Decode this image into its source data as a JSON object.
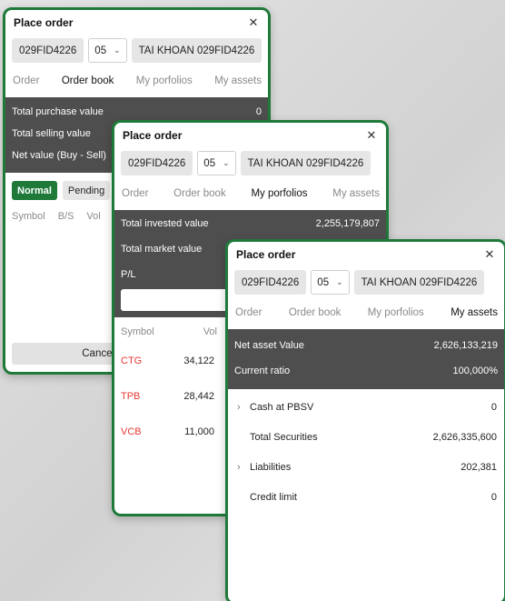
{
  "account": {
    "id": "029FID4226",
    "sub": "05",
    "name": "TAI KHOAN 029FID4226"
  },
  "icons": {
    "close": "close-icon",
    "dropdown": "chevron-down-icon",
    "loading": "loading-icon",
    "expand": "chevron-right-icon"
  },
  "colors": {
    "accent": "#1f7a3a",
    "summary_bg": "#4e4e4e",
    "symbol": "#e53935"
  },
  "panel1": {
    "title": "Place order",
    "tabs": [
      "Order",
      "Order book",
      "My porfolios",
      "My assets"
    ],
    "summary": [
      {
        "label": "Total purchase value",
        "value": "0"
      },
      {
        "label": "Total selling value",
        "value": ""
      },
      {
        "label": "Net value (Buy - Sell)",
        "value": ""
      }
    ],
    "toggles": [
      "Normal",
      "Pending"
    ],
    "columns": [
      "Symbol",
      "B/S",
      "Vol"
    ],
    "cancel_label": "Cancel all"
  },
  "panel2": {
    "title": "Place order",
    "tabs": [
      "Order",
      "Order book",
      "My porfolios",
      "My assets"
    ],
    "summary": [
      {
        "label": "Total invested value",
        "value": "2,255,179,807"
      },
      {
        "label": "Total market value",
        "value": ""
      },
      {
        "label": "P/L",
        "value": ""
      }
    ],
    "columns": [
      "Symbol",
      "Vol"
    ],
    "rows": [
      {
        "symbol": "CTG",
        "vol": "34,122"
      },
      {
        "symbol": "TPB",
        "vol": "28,442"
      },
      {
        "symbol": "VCB",
        "vol": "11,000"
      }
    ]
  },
  "panel3": {
    "title": "Place order",
    "tabs": [
      "Order",
      "Order book",
      "My porfolios",
      "My assets"
    ],
    "summary": [
      {
        "label": "Net asset Value",
        "value": "2,626,133,219"
      },
      {
        "label": "Current ratio",
        "value": "100,000%"
      }
    ],
    "assets": [
      {
        "label": "Cash at PBSV",
        "value": "0",
        "expandable": true
      },
      {
        "label": "Total Securities",
        "value": "2,626,335,600",
        "expandable": false
      },
      {
        "label": "Liabilities",
        "value": "202,381",
        "expandable": true
      },
      {
        "label": "Credit limit",
        "value": "0",
        "expandable": false
      }
    ]
  }
}
